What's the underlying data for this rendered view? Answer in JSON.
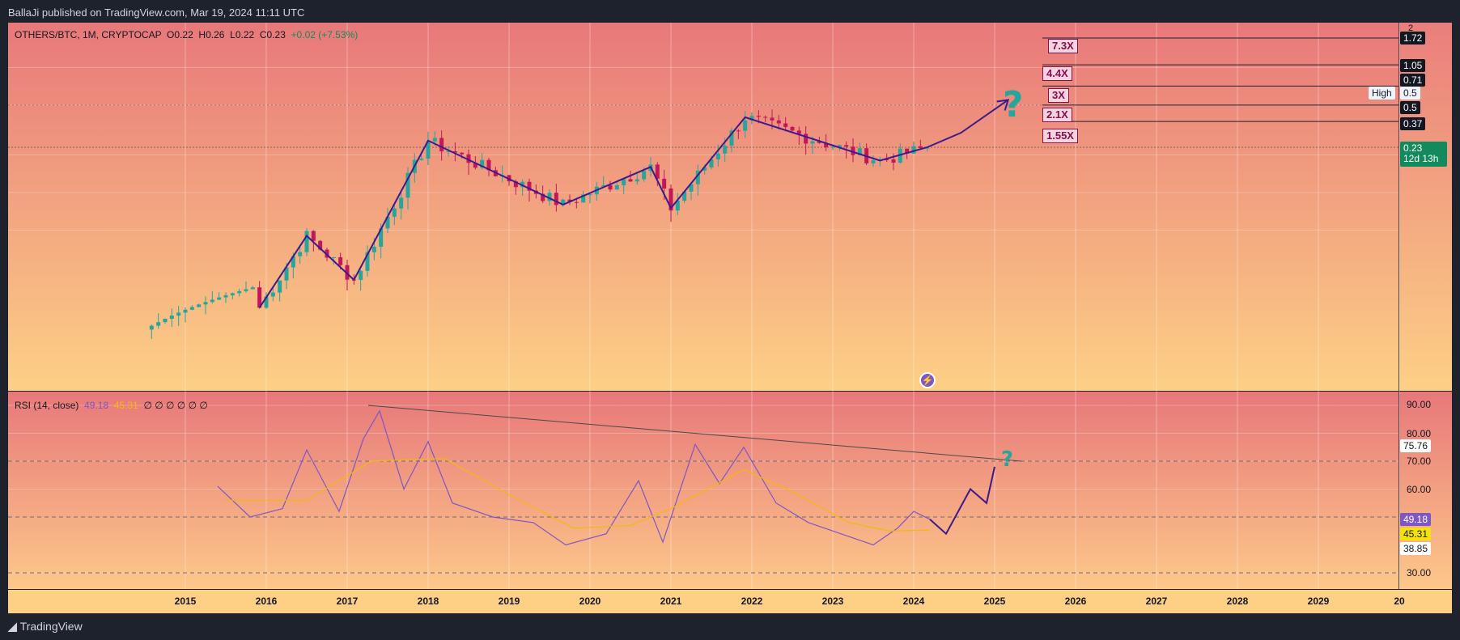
{
  "header": {
    "published": "BallaJi published on TradingView.com, Mar 19, 2024 11:11 UTC"
  },
  "footer": {
    "brand": "TradingView"
  },
  "legend": {
    "symbol": "OTHERS/BTC, 1M, CRYPTOCAP",
    "o_label": "O",
    "o": "0.22",
    "h_label": "H",
    "h": "0.26",
    "l_label": "L",
    "l": "0.22",
    "c_label": "C",
    "c": "0.23",
    "change": "+0.02 (+7.53%)"
  },
  "rsi_legend": {
    "title": "RSI (14, close)",
    "rsi": "49.18",
    "ma": "45.31",
    "empties": "∅ ∅ ∅ ∅ ∅ ∅"
  },
  "price_labels": {
    "top_tick": "2",
    "l1": "1.72",
    "l2": "1.05",
    "l3": "0.71",
    "high_tag": "High",
    "high_val": "0.5",
    "l4": "0.5",
    "l5": "0.37",
    "last": "0.23",
    "countdown": "12d 13h"
  },
  "multipliers": [
    "7.3X",
    "4.4X",
    "3X",
    "2.1X",
    "1.55X"
  ],
  "rsi_axis": {
    "ticks": [
      "90.00",
      "80.00",
      "70.00",
      "60.00",
      "30.00"
    ],
    "label_upper": "75.76",
    "label_rsi": "49.18",
    "label_ma": "45.31",
    "label_lower": "38.85"
  },
  "annotations": {
    "question": "?",
    "bolt": "⚡"
  },
  "colors": {
    "bull": "#26a69a",
    "bear": "#c2185b",
    "drawing": "#3d1a8c",
    "rsi": "#7e57c2",
    "rsi_ma": "#f2b90d",
    "bg_top": "#e8787a",
    "bg_bottom": "#fdd086"
  },
  "chart_data": [
    {
      "type": "candlestick",
      "title": "OTHERS/BTC, 1M, CRYPTOCAP",
      "y_scale": "log",
      "x_ticks": [
        "2015",
        "2016",
        "2017",
        "2018",
        "2019",
        "2020",
        "2021",
        "2022",
        "2023",
        "2024",
        "2025",
        "2026",
        "2027",
        "2028",
        "2029",
        "20"
      ],
      "price_levels": [
        1.72,
        1.05,
        0.71,
        0.5,
        0.37,
        0.23
      ],
      "multiplier_labels": [
        "7.3X",
        "4.4X",
        "3X",
        "2.1X",
        "1.55X"
      ],
      "approx_swing_points": [
        {
          "date": "2015-12",
          "value": 0.012
        },
        {
          "date": "2016-07",
          "value": 0.045
        },
        {
          "date": "2017-02",
          "value": 0.02
        },
        {
          "date": "2018-01",
          "value": 0.26
        },
        {
          "date": "2019-09",
          "value": 0.08
        },
        {
          "date": "2020-10",
          "value": 0.16
        },
        {
          "date": "2021-01",
          "value": 0.075
        },
        {
          "date": "2021-12",
          "value": 0.4
        },
        {
          "date": "2023-08",
          "value": 0.18
        },
        {
          "date": "2024-03",
          "value": 0.23
        }
      ],
      "last": {
        "open": 0.22,
        "high": 0.26,
        "low": 0.22,
        "close": 0.23,
        "change": 0.02,
        "change_pct": 7.53
      },
      "grid": true
    },
    {
      "type": "line",
      "title": "RSI (14, close)",
      "ylim": [
        25,
        95
      ],
      "y_ticks": [
        30,
        60,
        70,
        80,
        90
      ],
      "bands": [
        30,
        50,
        70
      ],
      "series": [
        {
          "name": "RSI",
          "current": 49.18
        },
        {
          "name": "MA",
          "current": 45.31
        }
      ],
      "labels": [
        75.76,
        49.18,
        45.31,
        38.85
      ]
    }
  ]
}
